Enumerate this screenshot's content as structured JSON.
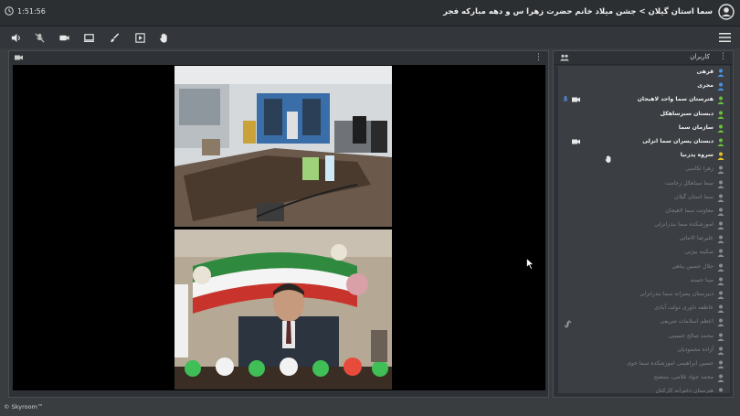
{
  "header": {
    "clock": "1:51:56",
    "title": "سما استان گیلان > جشن میلاد خانم حضرت زهرا س و دهه مبارکه فجر"
  },
  "toolbar": {
    "buttons": [
      "speaker-icon",
      "mic-muted-icon",
      "camera-icon",
      "screen-share-icon",
      "brush-icon",
      "play-icon",
      "hand-icon"
    ],
    "menu": "menu-icon"
  },
  "video_panel": {
    "dots": "⋮"
  },
  "users_panel": {
    "title": "کاربران",
    "dots": "⋮",
    "users": [
      {
        "name": "قرهی",
        "online": true,
        "icon": "#4a90e2"
      },
      {
        "name": "مجری",
        "online": true,
        "icon": "#4a90e2"
      },
      {
        "name": "هنرستان سما واحد لاهیجان",
        "online": true,
        "icon": "#6bbf3a",
        "mic": true,
        "cam": true
      },
      {
        "name": "دبستان سبزساهکل",
        "online": true,
        "icon": "#6bbf3a"
      },
      {
        "name": "سازمان سما",
        "online": true,
        "icon": "#6bbf3a"
      },
      {
        "name": "دبستان پسران سما انزلی",
        "online": true,
        "icon": "#6bbf3a",
        "cam": true
      },
      {
        "name": "سروه پدرنیا",
        "online": true,
        "icon": "#e6c229"
      },
      {
        "name": "زهرا تکاسی",
        "online": false,
        "icon": "#8a8d91"
      },
      {
        "name": "سما سیاهکل رحامت",
        "online": false,
        "icon": "#8a8d91"
      },
      {
        "name": "سما استان گیلان",
        "online": false,
        "icon": "#8a8d91"
      },
      {
        "name": "معاونت سما لاهیجان",
        "online": false,
        "icon": "#8a8d91"
      },
      {
        "name": "اموزشکده سما بندرانزلی",
        "online": false,
        "icon": "#8a8d91"
      },
      {
        "name": "علیرضا الاماتی",
        "online": false,
        "icon": "#8a8d91"
      },
      {
        "name": "سکینه بیژنی",
        "online": false,
        "icon": "#8a8d91"
      },
      {
        "name": "جلال حسین پناهی",
        "online": false,
        "icon": "#8a8d91"
      },
      {
        "name": "مینا حسنه",
        "online": false,
        "icon": "#8a8d91"
      },
      {
        "name": "دبیرستان پسرانه سما بندرانزلی",
        "online": false,
        "icon": "#8a8d91"
      },
      {
        "name": "عاطفه داوری دولت آبادی",
        "online": false,
        "icon": "#8a8d91"
      },
      {
        "name": "اعظم اسلامات شریفی",
        "online": false,
        "icon": "#8a8d91"
      },
      {
        "name": "محمد صالح حسینی",
        "online": false,
        "icon": "#8a8d91"
      },
      {
        "name": "آزاده محمودیان",
        "online": false,
        "icon": "#8a8d91"
      },
      {
        "name": "حسین ابراهیمی اموزشکده سما خوی",
        "online": false,
        "icon": "#8a8d91"
      },
      {
        "name": "محمد جواد غلامی، منتصح",
        "online": false,
        "icon": "#8a8d91"
      },
      {
        "name": "هنرستان دخترانه کارکنان",
        "online": false,
        "icon": "#8a8d91"
      }
    ]
  },
  "footer": {
    "brand": "© Skyroom™"
  },
  "colors": {
    "background": "#3a3d40",
    "panel": "#2e3135",
    "accent_blue": "#4a90e2",
    "accent_green": "#6bbf3a"
  }
}
